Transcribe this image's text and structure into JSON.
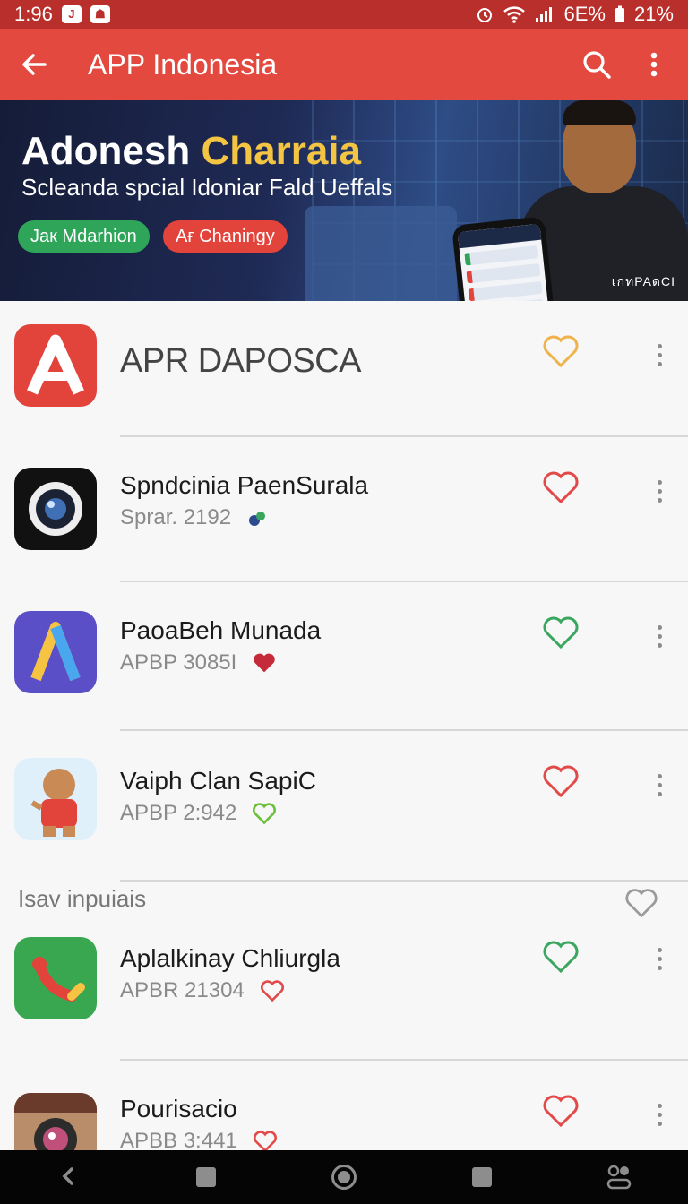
{
  "status_bar": {
    "time": "1:96",
    "badge1": "J",
    "badge2": "☗",
    "battery_saver": "6E%",
    "battery": "21%"
  },
  "app_bar": {
    "title": "APP Indonesia"
  },
  "banner": {
    "title_main": "Adonesh",
    "title_accent": "Charraia",
    "subtitle": "Scleanda spcial Idoniar Fald Ueffals",
    "chip_green": "Jaк Mdarhion",
    "chip_red": "Aғ Chaningy",
    "watermark": "เกทPAดCI"
  },
  "apps": [
    {
      "name": "APR DAPOSCA",
      "meta": "",
      "fav_color": "#f0b24a",
      "icon": "app-a-logo-icon"
    },
    {
      "name": "Spndcinia PaenSurala",
      "meta": "Sprar. 2192",
      "fav_color": "#e24a4a",
      "icon": "camera-lens-icon"
    },
    {
      "name": "PaoaBeh Munada",
      "meta": "APBP 3085I",
      "fav_color": "#3aa65f",
      "icon": "triangle-a-icon"
    },
    {
      "name": "Vaiph Clan SapiC",
      "meta": "APBP 2:942",
      "fav_color": "#e24a4a",
      "icon": "cartoon-character-icon"
    },
    {
      "name": "Aplalkinay Chliurgla",
      "meta": "APBR 21304",
      "fav_color": "#3aa65f",
      "icon": "green-phone-icon"
    },
    {
      "name": "Pourisacio",
      "meta": "APBB 3:441",
      "fav_color": "#e24a4a",
      "icon": "instagram-camera-icon"
    }
  ],
  "section": {
    "label": "Isav inpuiais"
  },
  "colors": {
    "accent": "#e4493f",
    "status": "#b82f2b",
    "green": "#2fa55a"
  }
}
